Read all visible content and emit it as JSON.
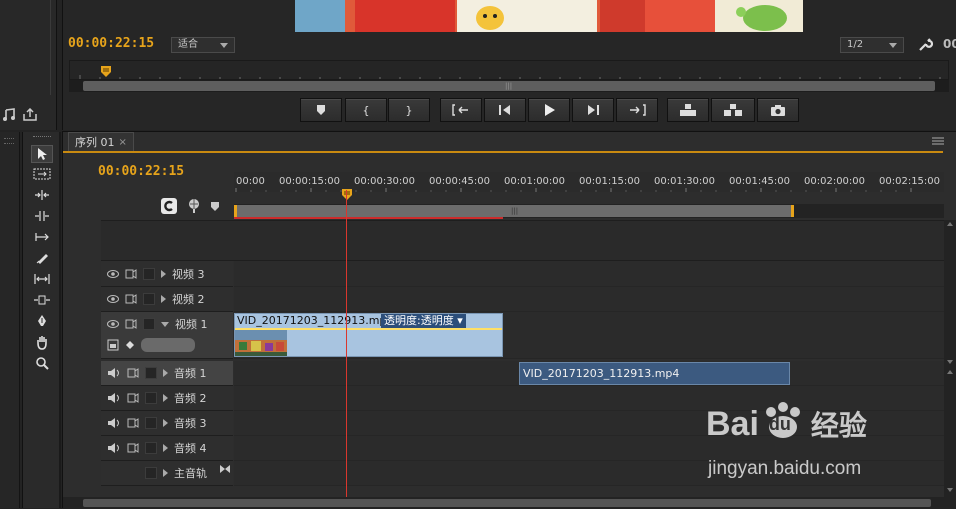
{
  "monitor": {
    "timecode": "00:00:22:15",
    "fit_dropdown": "适合",
    "resolution_dropdown": "1/2",
    "right_timecode_partial": "00",
    "transport_buttons": [
      {
        "icon": "marker-icon"
      },
      {
        "icon": "mark-in-icon",
        "label": "{"
      },
      {
        "icon": "mark-out-icon",
        "label": "}"
      },
      {
        "icon": "go-to-in-icon"
      },
      {
        "icon": "step-back-icon"
      },
      {
        "icon": "play-icon"
      },
      {
        "icon": "step-forward-icon"
      },
      {
        "icon": "go-to-out-icon"
      },
      {
        "icon": "lift-icon"
      },
      {
        "icon": "extract-icon"
      },
      {
        "icon": "export-frame-icon"
      }
    ]
  },
  "sequence": {
    "tab_label": "序列 01",
    "tab_close": "×",
    "timecode": "00:00:22:15",
    "ruler_labels": [
      "00:00",
      "00:00:15:00",
      "00:00:30:00",
      "00:00:45:00",
      "00:01:00:00",
      "00:01:15:00",
      "00:01:30:00",
      "00:01:45:00",
      "00:02:00:00",
      "00:02:15:00"
    ],
    "video_tracks": [
      {
        "name": "视频 3"
      },
      {
        "name": "视频 2"
      },
      {
        "name": "视频 1"
      }
    ],
    "audio_tracks": [
      {
        "name": "音频 1"
      },
      {
        "name": "音频 2"
      },
      {
        "name": "音频 3"
      },
      {
        "name": "音频 4"
      }
    ],
    "master_track": "主音轨",
    "clips": {
      "video1": {
        "filename": "VID_20171203_112913.mp4",
        "effect": "透明度:透明度"
      },
      "audio1": {
        "filename": "VID_20171203_112913.mp4"
      }
    }
  },
  "tools": [
    "selection-tool-icon",
    "track-select-tool-icon",
    "ripple-edit-tool-icon",
    "rolling-edit-tool-icon",
    "rate-stretch-tool-icon",
    "razor-tool-icon",
    "slip-tool-icon",
    "slide-tool-icon",
    "pen-tool-icon",
    "hand-tool-icon",
    "zoom-tool-icon"
  ],
  "watermark": {
    "brand_latin": "Bai",
    "brand_paw": "du",
    "brand_cn": "经验",
    "url": "jingyan.baidu.com"
  },
  "colors": {
    "timecode": "#e7a41b",
    "playhead": "#d9372e",
    "video_clip": "#a8c4e0",
    "audio_clip": "#3c5a80"
  }
}
